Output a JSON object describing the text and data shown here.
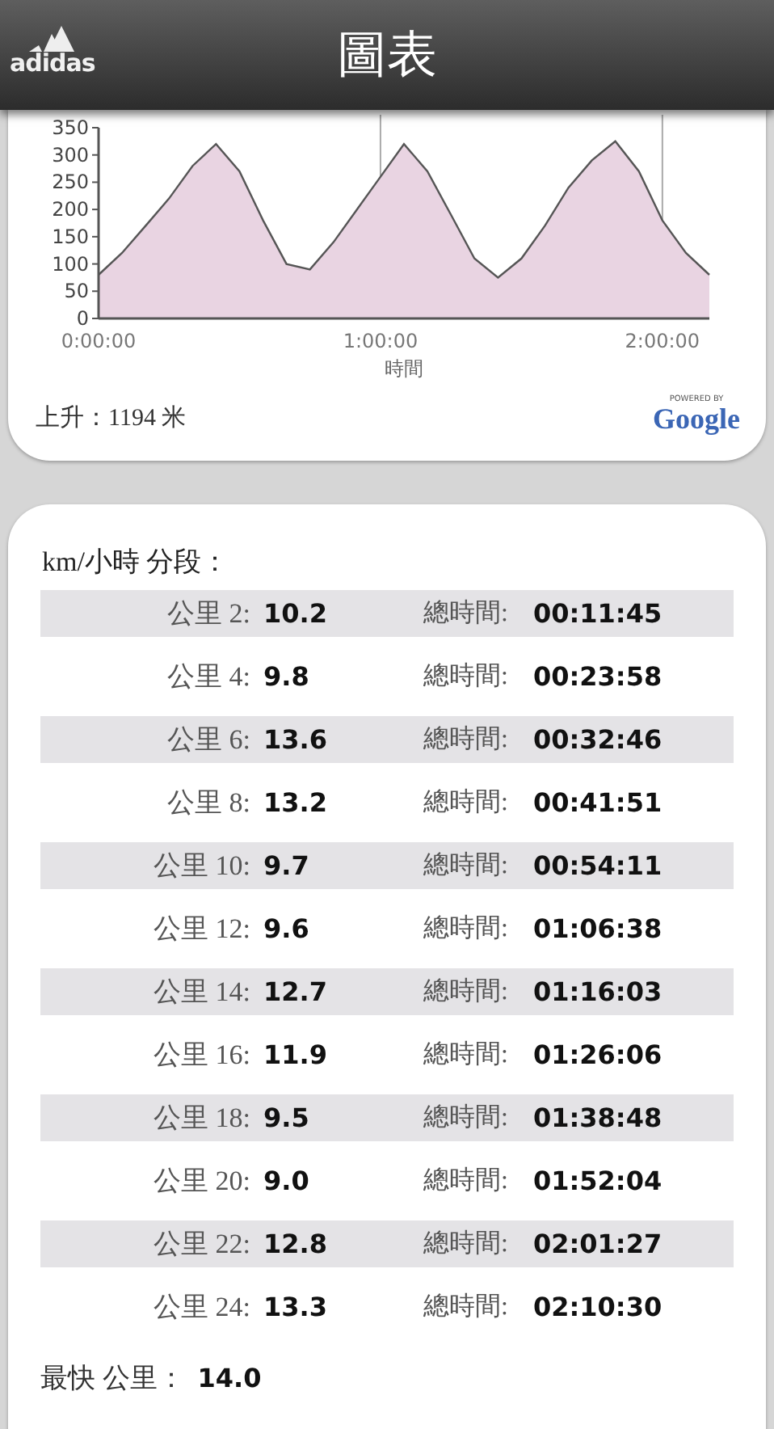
{
  "header": {
    "logo_text": "adidas",
    "title": "圖表"
  },
  "elevation": {
    "chart_data": {
      "type": "area",
      "xlabel": "時間",
      "x": [
        0,
        5,
        10,
        15,
        20,
        25,
        30,
        35,
        40,
        45,
        50,
        55,
        60,
        65,
        70,
        75,
        80,
        85,
        90,
        95,
        100,
        105,
        110,
        115,
        120,
        125,
        130
      ],
      "series": [
        {
          "color": "#e9d4e2",
          "values": [
            80,
            120,
            170,
            220,
            280,
            320,
            270,
            180,
            100,
            90,
            140,
            200,
            260,
            320,
            270,
            190,
            110,
            75,
            110,
            170,
            240,
            290,
            325,
            270,
            180,
            120,
            80
          ]
        }
      ],
      "ylim": [
        0,
        350
      ],
      "xlim": [
        0,
        130
      ],
      "yticks": [
        0,
        50,
        100,
        150,
        200,
        250,
        300,
        350
      ],
      "xticks": [
        {
          "value": 0,
          "label": "0:00:00"
        },
        {
          "value": 60,
          "label": "1:00:00"
        },
        {
          "value": 120,
          "label": "2:00:00"
        }
      ]
    },
    "ascent": "上升：1194 米",
    "powered_caption": "POWERED BY",
    "powered_name": "Google"
  },
  "splits": {
    "title": "km/小時 分段：",
    "rows": [
      {
        "km": "公里 2:",
        "speed": "10.2",
        "total_label": "總時間:",
        "total": "00:11:45"
      },
      {
        "km": "公里 4:",
        "speed": "9.8",
        "total_label": "總時間:",
        "total": "00:23:58"
      },
      {
        "km": "公里 6:",
        "speed": "13.6",
        "total_label": "總時間:",
        "total": "00:32:46"
      },
      {
        "km": "公里 8:",
        "speed": "13.2",
        "total_label": "總時間:",
        "total": "00:41:51"
      },
      {
        "km": "公里 10:",
        "speed": "9.7",
        "total_label": "總時間:",
        "total": "00:54:11"
      },
      {
        "km": "公里 12:",
        "speed": "9.6",
        "total_label": "總時間:",
        "total": "01:06:38"
      },
      {
        "km": "公里 14:",
        "speed": "12.7",
        "total_label": "總時間:",
        "total": "01:16:03"
      },
      {
        "km": "公里 16:",
        "speed": "11.9",
        "total_label": "總時間:",
        "total": "01:26:06"
      },
      {
        "km": "公里 18:",
        "speed": "9.5",
        "total_label": "總時間:",
        "total": "01:38:48"
      },
      {
        "km": "公里 20:",
        "speed": "9.0",
        "total_label": "總時間:",
        "total": "01:52:04"
      },
      {
        "km": "公里 22:",
        "speed": "12.8",
        "total_label": "總時間:",
        "total": "02:01:27"
      },
      {
        "km": "公里 24:",
        "speed": "13.3",
        "total_label": "總時間:",
        "total": "02:10:30"
      }
    ],
    "fastest_label": "最快 公里：",
    "fastest_value": "14.0"
  }
}
